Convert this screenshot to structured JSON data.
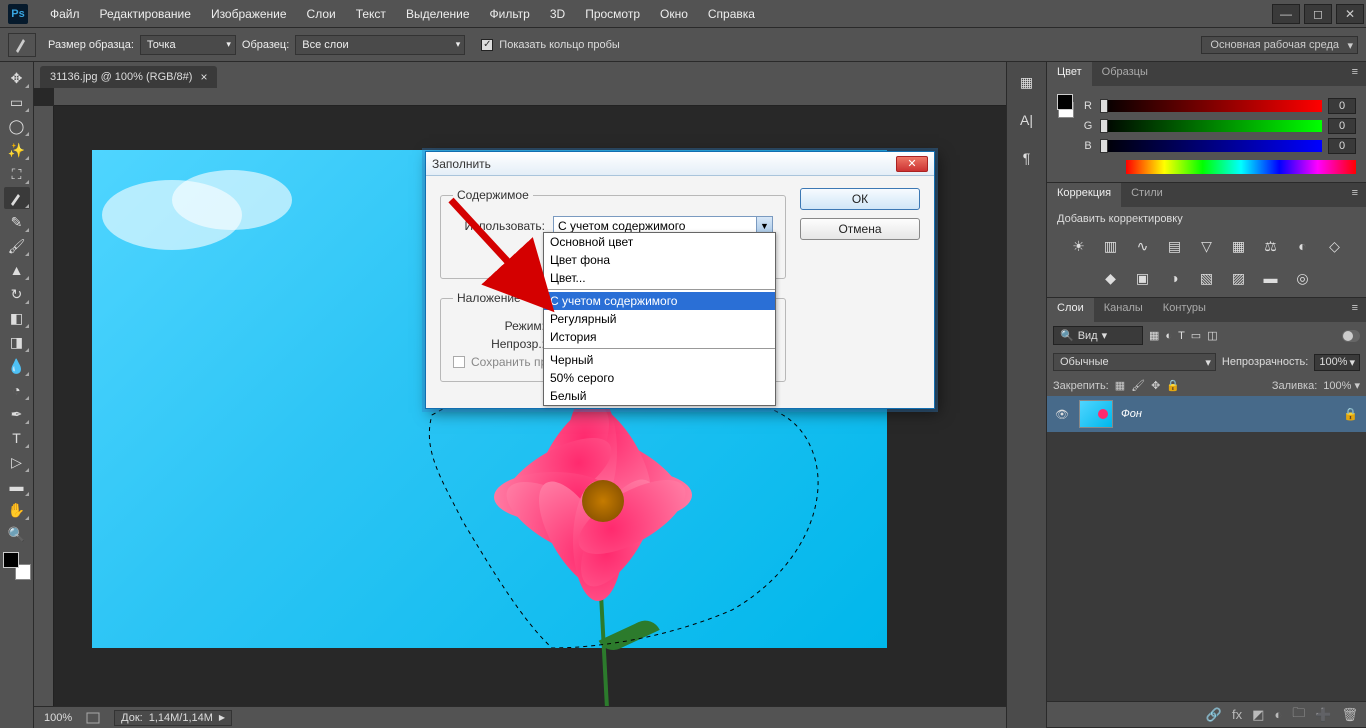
{
  "menubar": {
    "items": [
      "Файл",
      "Редактирование",
      "Изображение",
      "Слои",
      "Текст",
      "Выделение",
      "Фильтр",
      "3D",
      "Просмотр",
      "Окно",
      "Справка"
    ],
    "logo": "Ps"
  },
  "options": {
    "sample_size_label": "Размер образца:",
    "sample_size_value": "Точка",
    "sample_label": "Образец:",
    "sample_value": "Все слои",
    "show_ring_label": "Показать кольцо пробы",
    "workspace": "Основная рабочая среда"
  },
  "document": {
    "tab_title": "31136.jpg @ 100% (RGB/8#)",
    "zoom": "100%",
    "doc_info_label": "Док:",
    "doc_info": "1,14M/1,14M"
  },
  "dialog": {
    "title": "Заполнить",
    "group_content": "Содержимое",
    "use_label": "Использовать:",
    "use_value": "С учетом содержимого",
    "group_blend": "Наложение",
    "mode_label": "Режим:",
    "opacity_label": "Непрозр.:",
    "preserve_label": "Сохранить прозрачность",
    "ok": "ОК",
    "cancel": "Отмена"
  },
  "dropdown": {
    "options": [
      "Основной цвет",
      "Цвет фона",
      "Цвет...",
      null,
      "С учетом содержимого",
      "Регулярный",
      "История",
      null,
      "Черный",
      "50% серого",
      "Белый"
    ],
    "selected_index": 4
  },
  "panels": {
    "color_tab": "Цвет",
    "swatches_tab": "Образцы",
    "rgb": {
      "r_label": "R",
      "g_label": "G",
      "b_label": "B",
      "r": "0",
      "g": "0",
      "b": "0"
    },
    "adjustments_tab": "Коррекция",
    "styles_tab": "Стили",
    "adjustments_hint": "Добавить корректировку",
    "layers_tab": "Слои",
    "channels_tab": "Каналы",
    "paths_tab": "Контуры",
    "layer_search_mode": "Вид",
    "blend_mode": "Обычные",
    "opacity_label": "Непрозрачность:",
    "opacity_value": "100%",
    "lock_label": "Закрепить:",
    "fill_label": "Заливка:",
    "fill_value": "100%",
    "layer_name": "Фон"
  }
}
